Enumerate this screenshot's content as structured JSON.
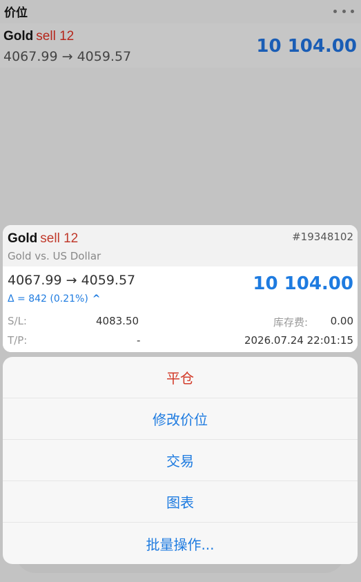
{
  "header": {
    "title": "价位",
    "more_icon": "more-dots-icon"
  },
  "position_row": {
    "symbol": "Gold",
    "side": "sell 12",
    "prices": "4067.99 → 4059.57",
    "profit": "10 104.00"
  },
  "card": {
    "symbol": "Gold",
    "side": "sell 12",
    "ticket": "#19348102",
    "description": "Gold vs. US Dollar",
    "prices": "4067.99 → 4059.57",
    "profit": "10 104.00",
    "delta": "Δ = 842 (0.21%)",
    "delta_icon": "^",
    "sl_label": "S/L:",
    "sl_value": "4083.50",
    "swap_label": "库存费:",
    "swap_value": "0.00",
    "tp_label": "T/P:",
    "tp_value": "-",
    "time": "2026.07.24 22:01:15"
  },
  "actions": {
    "close": "平仓",
    "modify": "修改价位",
    "trade": "交易",
    "chart": "图表",
    "bulk": "批量操作..."
  },
  "colors": {
    "sell": "#c0392b",
    "profit": "#1e7be0",
    "danger": "#d23a28"
  }
}
